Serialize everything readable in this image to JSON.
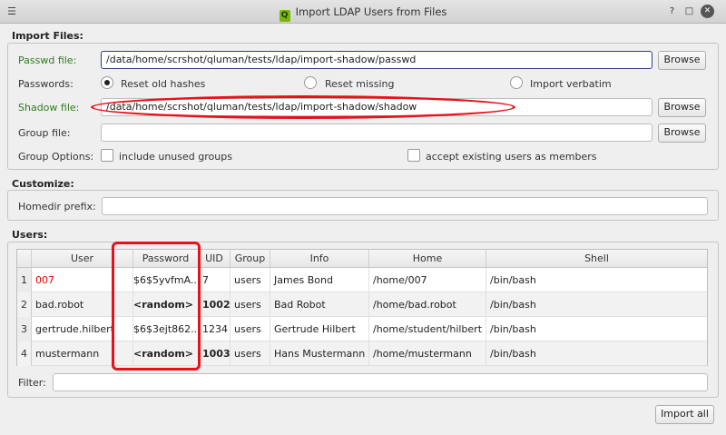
{
  "window": {
    "title": "Import LDAP Users from Files",
    "menu_icon": "menu-icon",
    "app_icon": "qluman-icon",
    "app_icon_glyph": "Q",
    "help_glyph": "?",
    "maximize_glyph": "□",
    "close_glyph": "✕"
  },
  "import_files": {
    "section_title": "Import Files:",
    "passwd_label": "Passwd file:",
    "passwd_value": "/data/home/scrshot/qluman/tests/ldap/import-shadow/passwd",
    "passwd_browse": "Browse",
    "passwords_label": "Passwords:",
    "radio_options": [
      "Reset old hashes",
      "Reset missing",
      "Import verbatim"
    ],
    "radio_selected": "Reset old hashes",
    "shadow_label": "Shadow file:",
    "shadow_value": "/data/home/scrshot/qluman/tests/ldap/import-shadow/shadow",
    "shadow_browse": "Browse",
    "group_label": "Group file:",
    "group_value": "",
    "group_browse": "Browse",
    "group_options_label": "Group Options:",
    "include_unused_label": "include unused groups",
    "accept_existing_label": "accept existing users as members"
  },
  "customize": {
    "section_title": "Customize:",
    "homedir_label": "Homedir prefix:",
    "homedir_value": ""
  },
  "users": {
    "section_title": "Users:",
    "columns": [
      "User",
      "Password",
      "UID",
      "Group",
      "Info",
      "Home",
      "Shell"
    ],
    "rows": [
      {
        "num": "1",
        "user": "007",
        "password": "$6$5yvfmA...",
        "uid": "7",
        "group": "users",
        "info": "James Bond",
        "home": "/home/007",
        "shell": "/bin/bash"
      },
      {
        "num": "2",
        "user": "bad.robot",
        "password": "<random>",
        "uid": "1002",
        "group": "users",
        "info": "Bad Robot",
        "home": "/home/bad.robot",
        "shell": "/bin/bash"
      },
      {
        "num": "3",
        "user": "gertrude.hilbert",
        "password": "$6$3ejt862...",
        "uid": "1234",
        "group": "users",
        "info": "Gertrude Hilbert",
        "home": "/home/student/hilbert",
        "shell": "/bin/bash"
      },
      {
        "num": "4",
        "user": "mustermann",
        "password": "<random>",
        "uid": "1003",
        "group": "users",
        "info": "Hans Mustermann",
        "home": "/home/mustermann",
        "shell": "/bin/bash"
      }
    ],
    "filter_label": "Filter:",
    "filter_value": ""
  },
  "footer": {
    "import_all": "Import all"
  },
  "colors": {
    "annotation": "#e8101a",
    "label_green": "#2e7d1a",
    "user_red": "#e00000"
  }
}
